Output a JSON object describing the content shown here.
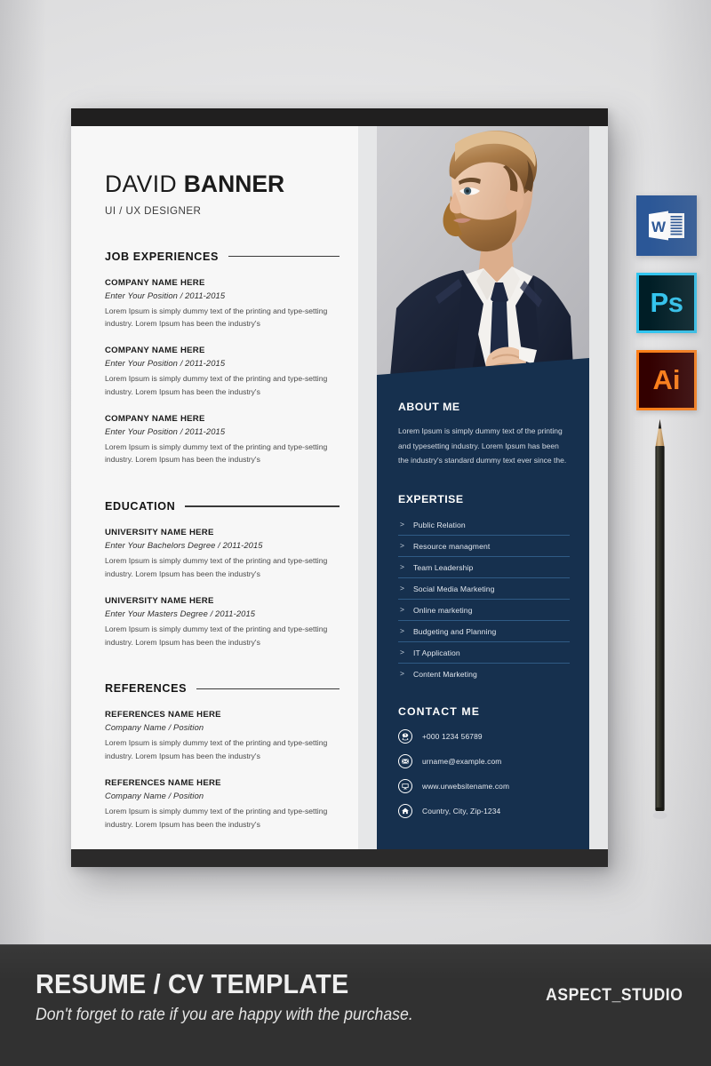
{
  "resume": {
    "header": {
      "first_name": "DAVID",
      "last_name": "BANNER",
      "role": "UI / UX DESIGNER"
    },
    "sections": {
      "job_experiences": {
        "heading": "JOB EXPERIENCES",
        "entries": [
          {
            "title": "COMPANY NAME HERE",
            "subtitle": "Enter Your Position / 2011-2015",
            "body": "Lorem Ipsum  is simply dummy text  of the printing and type-setting industry. Lorem Ipsum has been the industry's"
          },
          {
            "title": "COMPANY NAME HERE",
            "subtitle": "Enter Your Position / 2011-2015",
            "body": "Lorem Ipsum  is simply dummy text  of the printing and type-setting industry. Lorem Ipsum has been the industry's"
          },
          {
            "title": "COMPANY NAME HERE",
            "subtitle": "Enter Your Position / 2011-2015",
            "body": "Lorem Ipsum  is simply dummy text  of the printing and type-setting industry. Lorem Ipsum has been the industry's"
          }
        ]
      },
      "education": {
        "heading": "EDUCATION",
        "entries": [
          {
            "title": "UNIVERSITY NAME HERE",
            "subtitle": "Enter Your Bachelors Degree / 2011-2015",
            "body": "Lorem Ipsum  is simply dummy text  of the printing and type-setting industry. Lorem Ipsum has been the industry's"
          },
          {
            "title": "UNIVERSITY NAME HERE",
            "subtitle": "Enter Your Masters Degree / 2011-2015",
            "body": "Lorem Ipsum  is simply dummy text  of the printing and type-setting industry. Lorem Ipsum has been the industry's"
          }
        ]
      },
      "references": {
        "heading": "REFERENCES",
        "entries": [
          {
            "title": "REFERENCES NAME HERE",
            "subtitle": "Company Name  / Position",
            "body": "Lorem Ipsum  is simply dummy text  of the printing and type-setting industry. Lorem Ipsum has been the industry's"
          },
          {
            "title": "REFERENCES NAME HERE",
            "subtitle": "Company Name  / Position",
            "body": "Lorem Ipsum  is simply dummy text  of the printing and type-setting industry. Lorem Ipsum has been the industry's"
          }
        ]
      },
      "about_me": {
        "heading": "ABOUT ME",
        "body": "Lorem Ipsum is simply dummy text of the printing and typesetting industry. Lorem Ipsum has been the industry's standard dummy text ever since the."
      },
      "expertise": {
        "heading": "EXPERTISE",
        "bullet": ">",
        "items": [
          "Public Relation",
          "Resource managment",
          "Team Leadership",
          "Social Media Marketing",
          "Online marketing",
          "Budgeting and Planning",
          "IT Application",
          "Content Marketing"
        ]
      },
      "contact_me": {
        "heading": "CONTACT  ME",
        "items": [
          {
            "icon": "phone-icon",
            "value": "+000 1234 56789"
          },
          {
            "icon": "envelope-icon",
            "value": "urname@example.com"
          },
          {
            "icon": "monitor-icon",
            "value": "www.urwebsitename.com"
          },
          {
            "icon": "home-icon",
            "value": "Country, City, Zip-1234"
          }
        ]
      }
    },
    "photo": {
      "alt": "portrait-photo-bearded-man-in-suit"
    }
  },
  "badges": [
    {
      "name": "microsoft-word-badge",
      "glyph": "W",
      "bg": "#2b5797",
      "fg": "#ffffff"
    },
    {
      "name": "adobe-photoshop-badge",
      "glyph": "Ps",
      "bg": "#001e26",
      "fg": "#31c5f0"
    },
    {
      "name": "adobe-illustrator-badge",
      "glyph": "Ai",
      "bg": "#330000",
      "fg": "#ff7f18"
    }
  ],
  "prop": {
    "pencil": "black-pencil"
  },
  "footer": {
    "title": "RESUME / CV TEMPLATE",
    "subtitle": "Don't forget to rate if you are happy with the purchase.",
    "brand": "ASPECT_STUDIO"
  },
  "colors": {
    "navy": "#16304e",
    "paper": "#f7f7f7",
    "bar": "#201f1f",
    "footer_bg": "#313131",
    "skill_rule": "#2f5b85"
  }
}
